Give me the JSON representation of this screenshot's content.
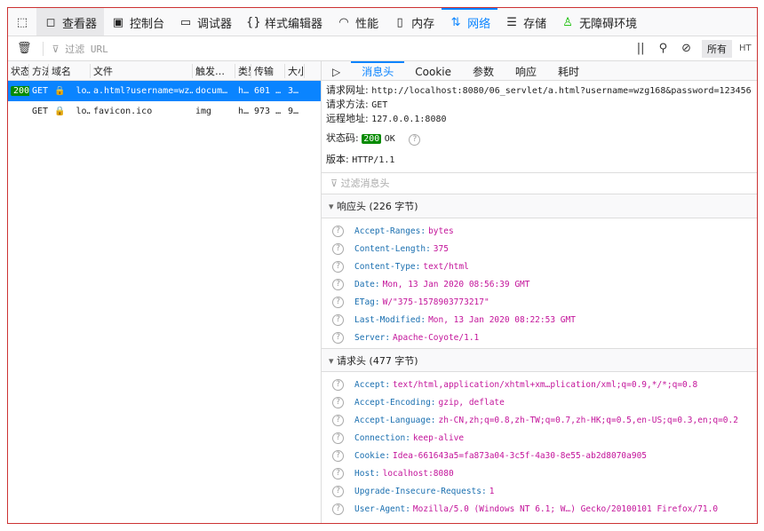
{
  "toolbar": {
    "tabs": [
      {
        "label": "查看器",
        "icon": "inspector-icon"
      },
      {
        "label": "控制台",
        "icon": "console-icon"
      },
      {
        "label": "调试器",
        "icon": "debugger-icon"
      },
      {
        "label": "样式编辑器",
        "icon": "style-editor-icon"
      },
      {
        "label": "性能",
        "icon": "performance-icon"
      },
      {
        "label": "内存",
        "icon": "memory-icon"
      },
      {
        "label": "网络",
        "icon": "network-icon"
      },
      {
        "label": "存储",
        "icon": "storage-icon"
      },
      {
        "label": "无障碍环境",
        "icon": "accessibility-icon"
      }
    ],
    "selected": "网络"
  },
  "filter": {
    "placeholder": "过滤 URL",
    "all_label": "所有",
    "html_label": "HTML"
  },
  "table": {
    "headers": [
      "状态",
      "方法",
      "域名",
      "文件",
      "触发…",
      "类型",
      "传输",
      "大小"
    ],
    "rows": [
      {
        "status": "200",
        "method": "GET",
        "domain": "lo…",
        "file": "a.html?username=wz…",
        "cause": "docum…",
        "type": "h…",
        "transferred": "601 …",
        "size": "3…"
      },
      {
        "status": "",
        "method": "GET",
        "domain": "lo…",
        "file": "favicon.ico",
        "cause": "img",
        "type": "h…",
        "transferred": "973 …",
        "size": "9…"
      }
    ]
  },
  "details": {
    "tabs": [
      "消息头",
      "Cookie",
      "参数",
      "响应",
      "耗时"
    ],
    "url_label": "请求网址:",
    "url": "http://localhost:8080/06_servlet/a.html?username=wzg168&password=123456",
    "method_label": "请求方法:",
    "method": "GET",
    "remote_label": "远程地址:",
    "remote": "127.0.0.1:8080",
    "status_label": "状态码:",
    "status": "200",
    "status_text": "OK",
    "version_label": "版本:",
    "version": "HTTP/1.1",
    "header_filter_placeholder": "过滤消息头",
    "response_headers_title": "响应头 (226 字节)",
    "response_headers": [
      [
        "Accept-Ranges:",
        "bytes"
      ],
      [
        "Content-Length:",
        "375"
      ],
      [
        "Content-Type:",
        "text/html"
      ],
      [
        "Date:",
        "Mon, 13 Jan 2020 08:56:39 GMT"
      ],
      [
        "ETag:",
        "W/\"375-1578903773217\""
      ],
      [
        "Last-Modified:",
        "Mon, 13 Jan 2020 08:22:53 GMT"
      ],
      [
        "Server:",
        "Apache-Coyote/1.1"
      ]
    ],
    "request_headers_title": "请求头 (477 字节)",
    "request_headers": [
      [
        "Accept:",
        "text/html,application/xhtml+xm…plication/xml;q=0.9,*/*;q=0.8"
      ],
      [
        "Accept-Encoding:",
        "gzip, deflate"
      ],
      [
        "Accept-Language:",
        "zh-CN,zh;q=0.8,zh-TW;q=0.7,zh-HK;q=0.5,en-US;q=0.3,en;q=0.2"
      ],
      [
        "Connection:",
        "keep-alive"
      ],
      [
        "Cookie:",
        "Idea-661643a5=fa873a04-3c5f-4a30-8e55-ab2d8070a905"
      ],
      [
        "Host:",
        "localhost:8080"
      ],
      [
        "Upgrade-Insecure-Requests:",
        "1"
      ],
      [
        "User-Agent:",
        "Mozilla/5.0 (Windows NT 6.1; W…) Gecko/20100101 Firefox/71.0"
      ]
    ]
  },
  "colors": {
    "accent": "#0a84ff",
    "status_ok": "#058b00",
    "header_key": "#1a6fb0",
    "header_value": "#c3149a"
  }
}
